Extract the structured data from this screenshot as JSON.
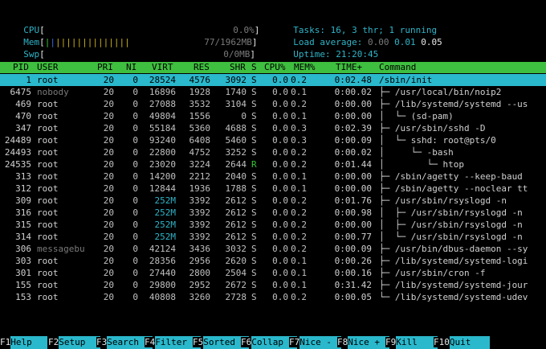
{
  "meters": {
    "cpu": {
      "label": "CPU",
      "value": "0.0%"
    },
    "mem": {
      "label": "Mem",
      "value": "77/1962MB"
    },
    "swp": {
      "label": "Swp",
      "value": "0/0MB"
    }
  },
  "summary": {
    "tasks_label": "Tasks:",
    "tasks_value": "16, 3 thr; 1 running",
    "load_label": "Load average:",
    "load_1": "0.00",
    "load_5": "0.01",
    "load_15": "0.05",
    "uptime_label": "Uptime:",
    "uptime_value": "21:20:45"
  },
  "columns": [
    "PID",
    "USER",
    "PRI",
    "NI",
    "VIRT",
    "RES",
    "SHR",
    "S",
    "CPU%",
    "MEM%",
    "TIME+",
    "Command"
  ],
  "processes": [
    {
      "pid": "1",
      "user": "root",
      "pri": "20",
      "ni": "0",
      "virt": "28524",
      "res": "4576",
      "shr": "3092",
      "s": "S",
      "cpu": "0.0",
      "mem": "0.2",
      "time": "0:02.48",
      "cmd": "/sbin/init",
      "selected": true
    },
    {
      "pid": "6475",
      "user": "nobody",
      "pri": "20",
      "ni": "0",
      "virt": "16896",
      "res": "1928",
      "shr": "1740",
      "s": "S",
      "cpu": "0.0",
      "mem": "0.1",
      "time": "0:00.02",
      "cmd": "├─ /usr/local/bin/noip2",
      "dim_user": true
    },
    {
      "pid": "469",
      "user": "root",
      "pri": "20",
      "ni": "0",
      "virt": "27088",
      "res": "3532",
      "shr": "3104",
      "s": "S",
      "cpu": "0.0",
      "mem": "0.2",
      "time": "0:00.00",
      "cmd": "├─ /lib/systemd/systemd --us"
    },
    {
      "pid": "470",
      "user": "root",
      "pri": "20",
      "ni": "0",
      "virt": "49804",
      "res": "1556",
      "shr": "0",
      "s": "S",
      "cpu": "0.0",
      "mem": "0.1",
      "time": "0:00.00",
      "cmd": "│  └─ (sd-pam)"
    },
    {
      "pid": "347",
      "user": "root",
      "pri": "20",
      "ni": "0",
      "virt": "55184",
      "res": "5360",
      "shr": "4688",
      "s": "S",
      "cpu": "0.0",
      "mem": "0.3",
      "time": "0:02.39",
      "cmd": "├─ /usr/sbin/sshd -D"
    },
    {
      "pid": "24489",
      "user": "root",
      "pri": "20",
      "ni": "0",
      "virt": "93240",
      "res": "6408",
      "shr": "5460",
      "s": "S",
      "cpu": "0.0",
      "mem": "0.3",
      "time": "0:00.09",
      "cmd": "│  └─ sshd: root@pts/0"
    },
    {
      "pid": "24493",
      "user": "root",
      "pri": "20",
      "ni": "0",
      "virt": "22800",
      "res": "4752",
      "shr": "3252",
      "s": "S",
      "cpu": "0.0",
      "mem": "0.2",
      "time": "0:00.02",
      "cmd": "│     └─ -bash"
    },
    {
      "pid": "24535",
      "user": "root",
      "pri": "20",
      "ni": "0",
      "virt": "23020",
      "res": "3224",
      "shr": "2644",
      "s": "R",
      "cpu": "0.0",
      "mem": "0.2",
      "time": "0:01.44",
      "cmd": "│        └─ htop",
      "running": true
    },
    {
      "pid": "313",
      "user": "root",
      "pri": "20",
      "ni": "0",
      "virt": "14200",
      "res": "2212",
      "shr": "2040",
      "s": "S",
      "cpu": "0.0",
      "mem": "0.1",
      "time": "0:00.00",
      "cmd": "├─ /sbin/agetty --keep-baud"
    },
    {
      "pid": "312",
      "user": "root",
      "pri": "20",
      "ni": "0",
      "virt": "12844",
      "res": "1936",
      "shr": "1788",
      "s": "S",
      "cpu": "0.0",
      "mem": "0.1",
      "time": "0:00.00",
      "cmd": "├─ /sbin/agetty --noclear tt"
    },
    {
      "pid": "309",
      "user": "root",
      "pri": "20",
      "ni": "0",
      "virt": "252M",
      "res": "3392",
      "shr": "2612",
      "s": "S",
      "cpu": "0.0",
      "mem": "0.2",
      "time": "0:01.76",
      "cmd": "├─ /usr/sbin/rsyslogd -n"
    },
    {
      "pid": "316",
      "user": "root",
      "pri": "20",
      "ni": "0",
      "virt": "252M",
      "res": "3392",
      "shr": "2612",
      "s": "S",
      "cpu": "0.0",
      "mem": "0.2",
      "time": "0:00.98",
      "cmd": "│  ├─ /usr/sbin/rsyslogd -n"
    },
    {
      "pid": "315",
      "user": "root",
      "pri": "20",
      "ni": "0",
      "virt": "252M",
      "res": "3392",
      "shr": "2612",
      "s": "S",
      "cpu": "0.0",
      "mem": "0.2",
      "time": "0:00.00",
      "cmd": "│  ├─ /usr/sbin/rsyslogd -n"
    },
    {
      "pid": "314",
      "user": "root",
      "pri": "20",
      "ni": "0",
      "virt": "252M",
      "res": "3392",
      "shr": "2612",
      "s": "S",
      "cpu": "0.0",
      "mem": "0.2",
      "time": "0:00.77",
      "cmd": "│  └─ /usr/sbin/rsyslogd -n"
    },
    {
      "pid": "306",
      "user": "messagebu",
      "pri": "20",
      "ni": "0",
      "virt": "42124",
      "res": "3436",
      "shr": "3032",
      "s": "S",
      "cpu": "0.0",
      "mem": "0.2",
      "time": "0:00.09",
      "cmd": "├─ /usr/bin/dbus-daemon --sy",
      "dim_user": true
    },
    {
      "pid": "303",
      "user": "root",
      "pri": "20",
      "ni": "0",
      "virt": "28356",
      "res": "2956",
      "shr": "2620",
      "s": "S",
      "cpu": "0.0",
      "mem": "0.1",
      "time": "0:00.26",
      "cmd": "├─ /lib/systemd/systemd-logi"
    },
    {
      "pid": "301",
      "user": "root",
      "pri": "20",
      "ni": "0",
      "virt": "27440",
      "res": "2800",
      "shr": "2504",
      "s": "S",
      "cpu": "0.0",
      "mem": "0.1",
      "time": "0:00.16",
      "cmd": "├─ /usr/sbin/cron -f"
    },
    {
      "pid": "155",
      "user": "root",
      "pri": "20",
      "ni": "0",
      "virt": "29800",
      "res": "2952",
      "shr": "2672",
      "s": "S",
      "cpu": "0.0",
      "mem": "0.1",
      "time": "0:31.42",
      "cmd": "├─ /lib/systemd/systemd-jour"
    },
    {
      "pid": "153",
      "user": "root",
      "pri": "20",
      "ni": "0",
      "virt": "40808",
      "res": "3260",
      "shr": "2728",
      "s": "S",
      "cpu": "0.0",
      "mem": "0.2",
      "time": "0:00.05",
      "cmd": "└─ /lib/systemd/systemd-udev"
    }
  ],
  "fkeys": [
    {
      "key": "F1",
      "label": "Help"
    },
    {
      "key": "F2",
      "label": "Setup"
    },
    {
      "key": "F3",
      "label": "Search"
    },
    {
      "key": "F4",
      "label": "Filter"
    },
    {
      "key": "F5",
      "label": "Sorted"
    },
    {
      "key": "F6",
      "label": "Collap"
    },
    {
      "key": "F7",
      "label": "Nice -"
    },
    {
      "key": "F8",
      "label": "Nice +"
    },
    {
      "key": "F9",
      "label": "Kill"
    },
    {
      "key": "F10",
      "label": "Quit"
    }
  ],
  "colors": {
    "header_bg": "#3fbf3f",
    "selected_bg": "#2ab8cc",
    "label_cyan": "#2fb4c8",
    "fkey_bg": "#2ab8cc"
  }
}
